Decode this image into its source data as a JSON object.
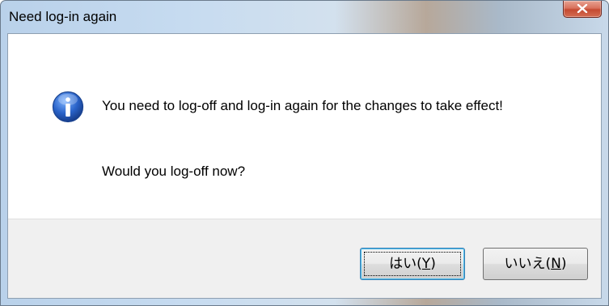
{
  "window": {
    "title": "Need log-in again",
    "close_icon": "close-x-icon"
  },
  "message": {
    "icon": "information-icon",
    "line1": "You need to log-off and log-in again for the changes to take effect!",
    "line2": "Would you log-off now?"
  },
  "buttons": {
    "yes": {
      "prefix": "はい(",
      "mnemonic": "Y",
      "suffix": ")"
    },
    "no": {
      "prefix": "いいえ(",
      "mnemonic": "N",
      "suffix": ")"
    }
  },
  "colors": {
    "info_icon": "#2a63c9",
    "close_button": "#c44a31",
    "default_button_border": "#3c7fb1"
  }
}
